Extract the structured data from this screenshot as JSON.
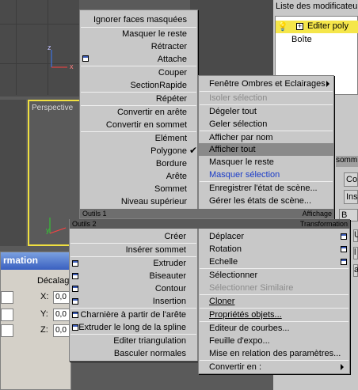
{
  "right_panel": {
    "modifier_list": "Liste des modificateur",
    "stack_items": [
      "Editer poly",
      "Boîte"
    ],
    "side_labels": [
      "somm",
      "Co",
      "Ins",
      "B",
      "U",
      "l",
      "a"
    ]
  },
  "viewport": {
    "perspective_label": "Perspective"
  },
  "transform_window": {
    "title": "rmation",
    "offset_label": "Décalag",
    "axes": [
      "X:",
      "Y:",
      "Z:"
    ],
    "values": [
      "0,0",
      "0,0",
      "0,0"
    ]
  },
  "quad_menu": {
    "top_left": {
      "items": [
        {
          "label": "Ignorer faces masquées",
          "checkbox": false
        },
        {
          "label": "Masquer le reste",
          "checkbox": false
        },
        {
          "label": "Rétracter",
          "checkbox": false
        },
        {
          "label": "Attache",
          "checkbox": true
        },
        {
          "label": "Couper",
          "checkbox": false
        },
        {
          "label": "SectionRapide",
          "checkbox": false
        },
        {
          "label": "Répéter",
          "checkbox": false
        },
        {
          "label": "Convertir en arête",
          "checkbox": false
        },
        {
          "label": "Convertir en sommet",
          "checkbox": false
        },
        {
          "label": "Elément",
          "checkbox": false
        },
        {
          "label": "Polygone",
          "checkbox": false,
          "checked": true
        },
        {
          "label": "Bordure",
          "checkbox": false
        },
        {
          "label": "Arête",
          "checkbox": false
        },
        {
          "label": "Sommet",
          "checkbox": false
        },
        {
          "label": "Niveau supérieur",
          "checkbox": false
        }
      ],
      "header": "Outils 1"
    },
    "top_right": {
      "header": "Affichage",
      "items": [
        {
          "label": "Fenêtre Ombres et Eclairages",
          "submenu": true
        },
        {
          "label": "Isoler sélection",
          "state": "disabled"
        },
        {
          "label": "Dégeler tout"
        },
        {
          "label": "Geler sélection"
        },
        {
          "label": "Afficher par nom"
        },
        {
          "label": "Afficher tout",
          "state": "highlighted"
        },
        {
          "label": "Masquer le reste"
        },
        {
          "label": "Masquer sélection",
          "state": "blue"
        },
        {
          "label": "Enregistrer l'état de scène..."
        },
        {
          "label": "Gérer les états de scène..."
        }
      ]
    },
    "bottom_left": {
      "header": "Outils 2",
      "items": [
        {
          "label": "Créer",
          "checkbox": false
        },
        {
          "label": "Insérer sommet",
          "checkbox": false
        },
        {
          "label": "Extruder",
          "checkbox": true
        },
        {
          "label": "Biseauter",
          "checkbox": true
        },
        {
          "label": "Contour",
          "checkbox": true
        },
        {
          "label": "Insertion",
          "checkbox": true
        },
        {
          "label": "Charnière à partir de l'arête",
          "checkbox": true
        },
        {
          "label": "Extruder le long de la spline",
          "checkbox": true
        },
        {
          "label": "Editer triangulation",
          "checkbox": false
        },
        {
          "label": "Basculer normales",
          "checkbox": false
        }
      ]
    },
    "bottom_right": {
      "header": "Transformation",
      "items": [
        {
          "label": "Déplacer",
          "checkbox": true
        },
        {
          "label": "Rotation",
          "checkbox": true
        },
        {
          "label": "Echelle",
          "checkbox": true
        },
        {
          "label": "Sélectionner"
        },
        {
          "label": "Sélectionner Similaire",
          "state": "disabled"
        },
        {
          "label": "Cloner"
        },
        {
          "label": "Propriétés objets..."
        },
        {
          "label": "Editeur de courbes..."
        },
        {
          "label": "Feuille d'expo..."
        },
        {
          "label": "Mise en relation des paramètres..."
        },
        {
          "label": "Convertir en :",
          "submenu": true
        }
      ]
    }
  },
  "axes_labels": {
    "z": "z",
    "x": "x",
    "y": "y"
  }
}
